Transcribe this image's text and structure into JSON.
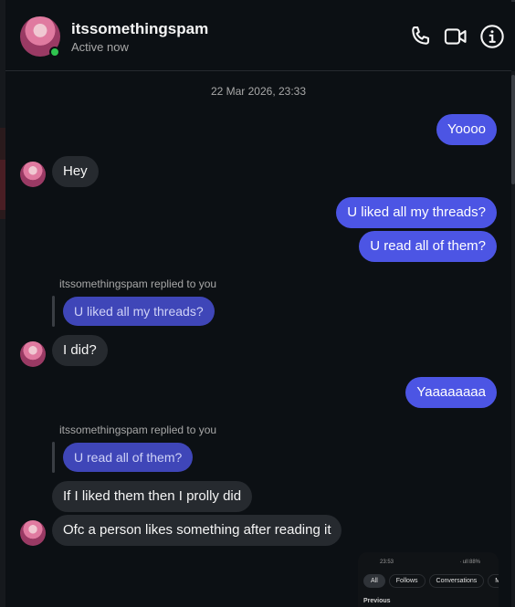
{
  "header": {
    "name": "itssomethingspam",
    "status": "Active now",
    "icons": [
      "phone-icon",
      "video-call-icon",
      "info-icon"
    ]
  },
  "conversation": {
    "timestamp": "22 Mar 2026, 23:33",
    "messages": [
      {
        "from": "me",
        "text": "Yoooo"
      },
      {
        "from": "them",
        "text": "Hey"
      },
      {
        "from": "me",
        "text": "U liked all my threads?"
      },
      {
        "from": "me",
        "text": "U read all of them?"
      },
      {
        "from": "them",
        "reply_note": "itssomethingspam replied to you",
        "quoted": "U liked all my threads?",
        "text": "I did?"
      },
      {
        "from": "me",
        "text": "Yaaaaaaaa"
      },
      {
        "from": "them",
        "reply_note": "itssomethingspam replied to you",
        "quoted": "U read all of them?",
        "text": "If I liked them then I prolly did"
      },
      {
        "from": "them",
        "text": "Ofc a person likes something after reading it"
      }
    ]
  },
  "attachment": {
    "status_time": "23:53",
    "status_right": "· ull 88%",
    "tabs": [
      "All",
      "Follows",
      "Conversations",
      "Ment"
    ],
    "active_tab": "All",
    "section": "Previous"
  },
  "colors": {
    "background": "#0c1014",
    "outgoing_bubble": "#4c55e4",
    "incoming_bubble": "#262a2f",
    "active_dot": "#2fc44f"
  }
}
